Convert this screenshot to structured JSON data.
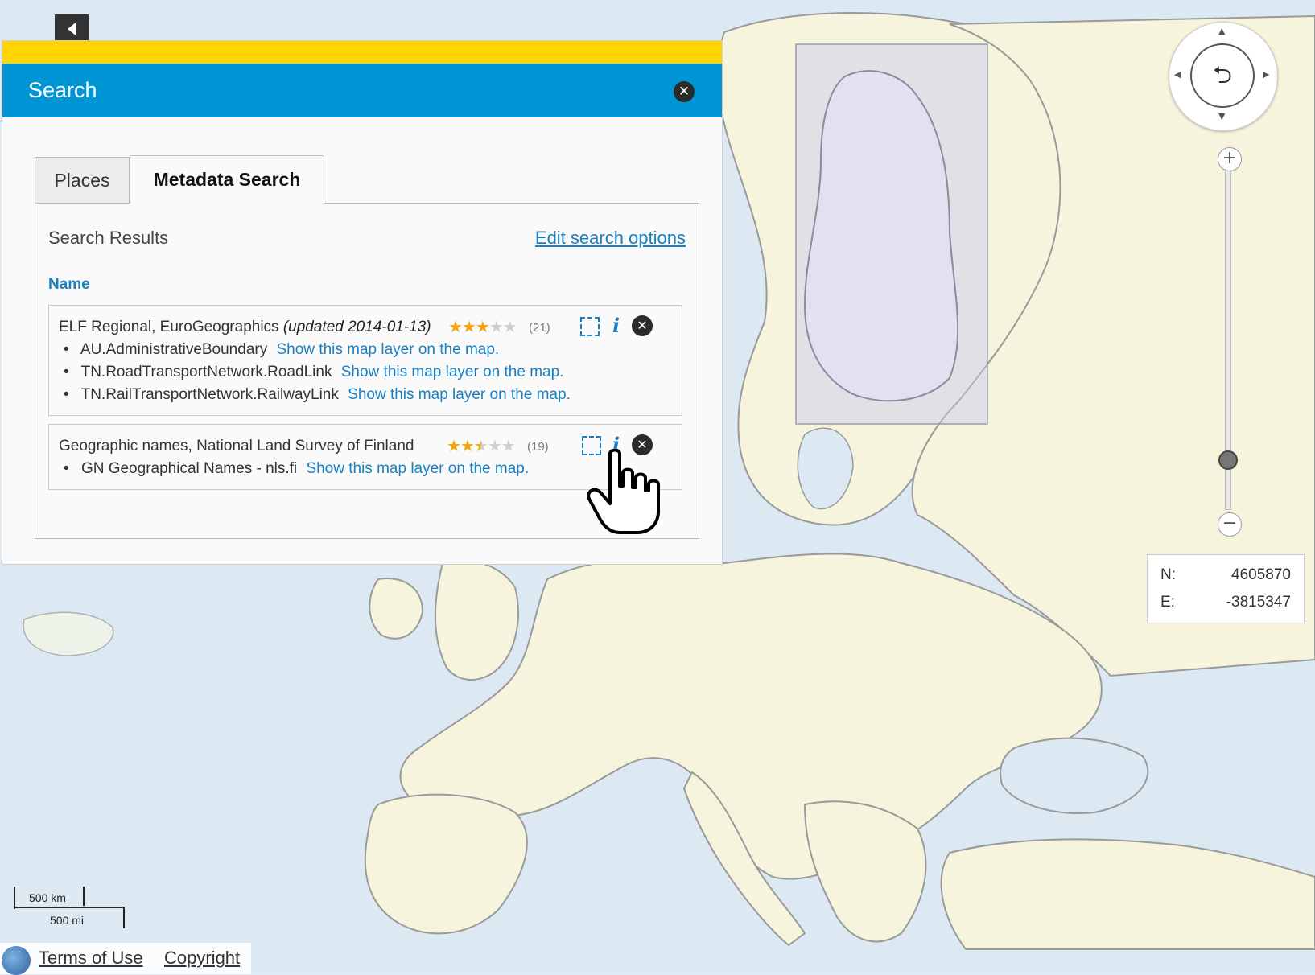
{
  "panel": {
    "title": "Search",
    "close_icon": "close-icon"
  },
  "tabs": [
    {
      "label": "Places",
      "active": false
    },
    {
      "label": "Metadata Search",
      "active": true
    }
  ],
  "results": {
    "title": "Search Results",
    "edit_link": "Edit search options",
    "column_header": "Name",
    "items": [
      {
        "title": "ELF Regional, EuroGeographics",
        "updated": "(updated 2014-01-13)",
        "rating": 3,
        "rating_max": 5,
        "rating_count": "(21)",
        "layers": [
          {
            "name": "AU.AdministrativeBoundary",
            "link": "Show this map layer on the map."
          },
          {
            "name": "TN.RoadTransportNetwork.RoadLink",
            "link": "Show this map layer on the map."
          },
          {
            "name": "TN.RailTransportNetwork.RailwayLink",
            "link": "Show this map layer on the map."
          }
        ]
      },
      {
        "title": "Geographic names, National Land Survey of Finland",
        "updated": "",
        "rating": 2.5,
        "rating_max": 5,
        "rating_count": "(19)",
        "layers": [
          {
            "name": "GN Geographical Names - nls.fi",
            "link": "Show this map layer on the map."
          }
        ]
      }
    ]
  },
  "coordinates": {
    "n_label": "N:",
    "n_value": "4605870",
    "e_label": "E:",
    "e_value": "-3815347"
  },
  "scale": {
    "km": "500 km",
    "mi": "500 mi"
  },
  "footer": {
    "terms": "Terms of Use",
    "copyright": "Copyright"
  },
  "colors": {
    "header_blue": "#0096d6",
    "accent_yellow": "#ffd400",
    "link_blue": "#1a7fc1",
    "star": "#f0a70a"
  }
}
